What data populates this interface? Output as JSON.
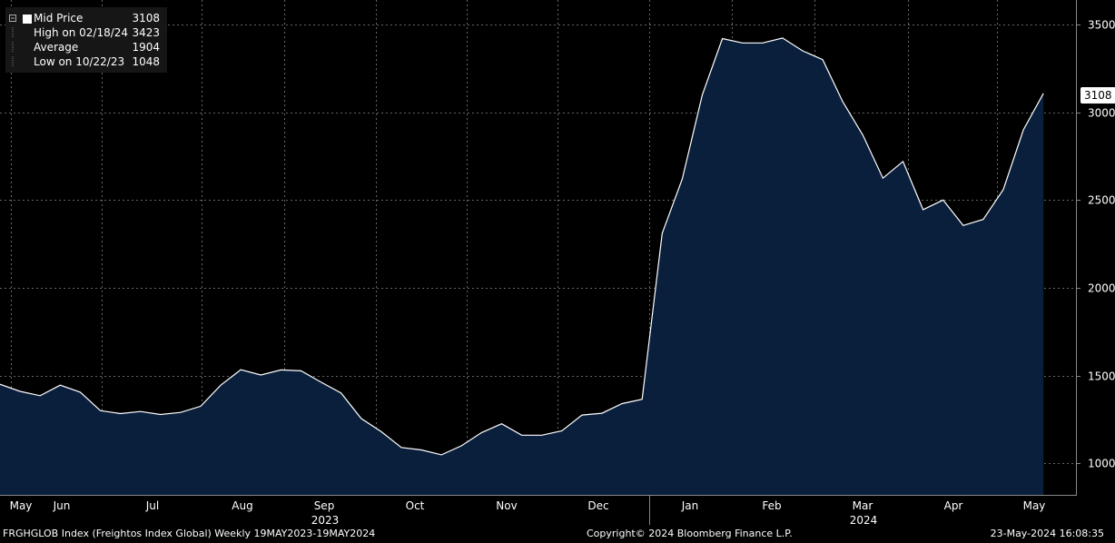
{
  "chart_data": {
    "type": "area",
    "x_ticks": [
      "May",
      "Jun",
      "Jul",
      "Aug",
      "Sep",
      "Oct",
      "Nov",
      "Dec",
      "Jan",
      "Feb",
      "Mar",
      "Apr",
      "May"
    ],
    "year_labels": [
      "2023",
      "2024"
    ],
    "y_ticks": [
      1000,
      1500,
      2000,
      2500,
      3000,
      3500
    ],
    "ylim": [
      820,
      3640
    ],
    "grid": true,
    "series": [
      {
        "name": "Mid Price",
        "values": [
          1450,
          1410,
          1385,
          1445,
          1405,
          1300,
          1283,
          1295,
          1278,
          1290,
          1325,
          1445,
          1533,
          1503,
          1532,
          1527,
          1462,
          1400,
          1255,
          1180,
          1090,
          1076,
          1048,
          1100,
          1175,
          1225,
          1160,
          1160,
          1185,
          1275,
          1285,
          1340,
          1365,
          2310,
          2620,
          3100,
          3420,
          3395,
          3395,
          3423,
          3350,
          3300,
          3060,
          2870,
          2625,
          2720,
          2445,
          2500,
          2355,
          2390,
          2560,
          2900,
          3108
        ]
      }
    ],
    "last_value": "3108"
  },
  "legend": {
    "items": [
      {
        "name": "Mid Price",
        "value": "3108"
      },
      {
        "name": "High on 02/18/24",
        "value": "3423"
      },
      {
        "name": "Average",
        "value": "1904"
      },
      {
        "name": "Low on 10/22/23",
        "value": "1048"
      }
    ]
  },
  "footer": {
    "left": "FRGHGLOB Index (Freightos Index Global)  Weekly 19MAY2023-19MAY2024",
    "center": "Copyright© 2024 Bloomberg Finance L.P.",
    "right": "23-May-2024 16:08:35"
  },
  "colors": {
    "fill": "#0a1f3c",
    "line": "#ffffff",
    "grid": "#666666",
    "background": "#000000"
  }
}
